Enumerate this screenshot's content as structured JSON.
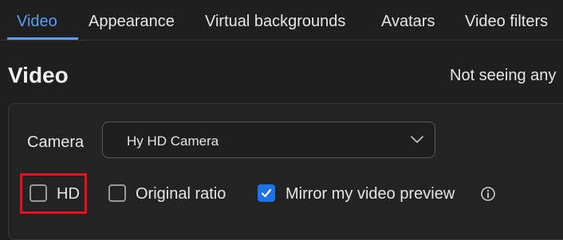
{
  "tabs": [
    {
      "label": "Video",
      "active": true
    },
    {
      "label": "Appearance",
      "active": false
    },
    {
      "label": "Virtual backgrounds",
      "active": false
    },
    {
      "label": "Avatars",
      "active": false
    },
    {
      "label": "Video filters",
      "active": false
    }
  ],
  "section": {
    "title": "Video",
    "help_text": "Not seeing any"
  },
  "camera": {
    "label": "Camera",
    "selected": "Hy HD Camera",
    "icon": "chevron-down-icon"
  },
  "options": {
    "hd": {
      "label": "HD",
      "checked": false
    },
    "original_ratio": {
      "label": "Original ratio",
      "checked": false
    },
    "mirror": {
      "label": "Mirror my video preview",
      "checked": true
    },
    "info_icon": "info-icon"
  },
  "colors": {
    "accent": "#5b9cf0",
    "checkbox_checked": "#1a73e8",
    "highlight": "#e8101c",
    "background": "#1f1f1f"
  }
}
